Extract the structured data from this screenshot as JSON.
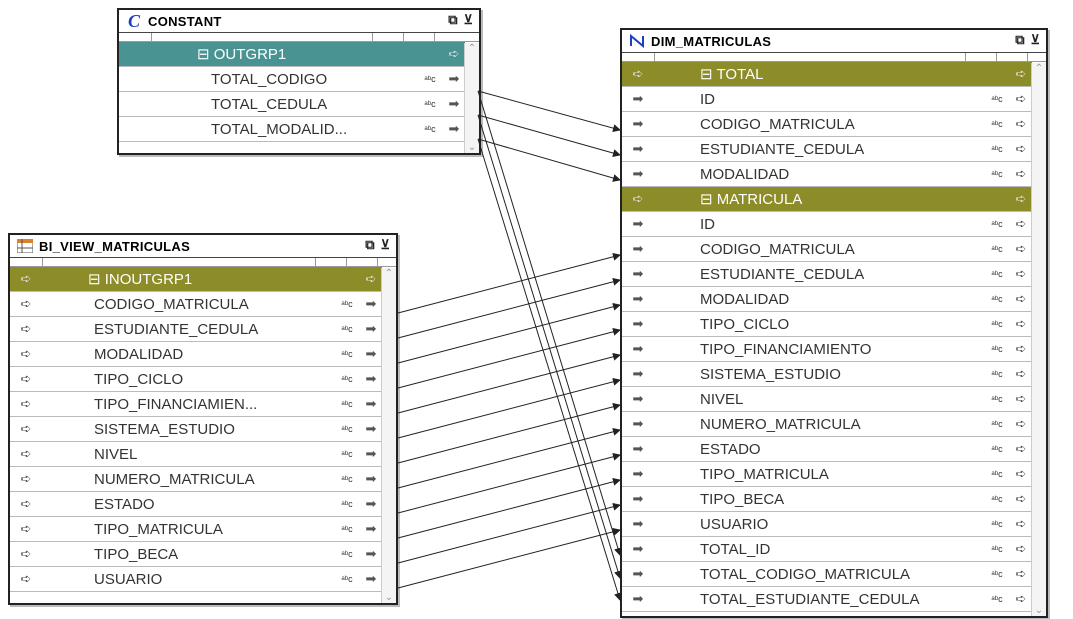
{
  "constant": {
    "title": "CONSTANT",
    "group": "OUTGRP1",
    "rows": [
      {
        "name": "TOTAL_CODIGO",
        "type": "str"
      },
      {
        "name": "TOTAL_CEDULA",
        "type": "str"
      },
      {
        "name": "TOTAL_MODALID...",
        "type": "str"
      }
    ]
  },
  "source": {
    "title": "BI_VIEW_MATRICULAS",
    "group": "INOUTGRP1",
    "rows": [
      {
        "name": "CODIGO_MATRICULA"
      },
      {
        "name": "ESTUDIANTE_CEDULA"
      },
      {
        "name": "MODALIDAD"
      },
      {
        "name": "TIPO_CICLO"
      },
      {
        "name": "TIPO_FINANCIAMIEN..."
      },
      {
        "name": "SISTEMA_ESTUDIO"
      },
      {
        "name": "NIVEL"
      },
      {
        "name": "NUMERO_MATRICULA"
      },
      {
        "name": "ESTADO"
      },
      {
        "name": "TIPO_MATRICULA"
      },
      {
        "name": "TIPO_BECA"
      },
      {
        "name": "USUARIO"
      }
    ]
  },
  "target": {
    "title": "DIM_MATRICULAS",
    "rows": [
      {
        "name": "TOTAL",
        "group": true
      },
      {
        "name": "ID"
      },
      {
        "name": "CODIGO_MATRICULA"
      },
      {
        "name": "ESTUDIANTE_CEDULA"
      },
      {
        "name": "MODALIDAD"
      },
      {
        "name": "MATRICULA",
        "group": true
      },
      {
        "name": "ID"
      },
      {
        "name": "CODIGO_MATRICULA"
      },
      {
        "name": "ESTUDIANTE_CEDULA"
      },
      {
        "name": "MODALIDAD"
      },
      {
        "name": "TIPO_CICLO"
      },
      {
        "name": "TIPO_FINANCIAMIENTO"
      },
      {
        "name": "SISTEMA_ESTUDIO"
      },
      {
        "name": "NIVEL"
      },
      {
        "name": "NUMERO_MATRICULA"
      },
      {
        "name": "ESTADO"
      },
      {
        "name": "TIPO_MATRICULA"
      },
      {
        "name": "TIPO_BECA"
      },
      {
        "name": "USUARIO"
      },
      {
        "name": "TOTAL_ID"
      },
      {
        "name": "TOTAL_CODIGO_MATRICULA"
      },
      {
        "name": "TOTAL_ESTUDIANTE_CEDULA"
      }
    ]
  },
  "colors": {
    "constant_group": "#4a9393",
    "target_group": "#8c8c28",
    "source_group": "#8c8c28"
  }
}
